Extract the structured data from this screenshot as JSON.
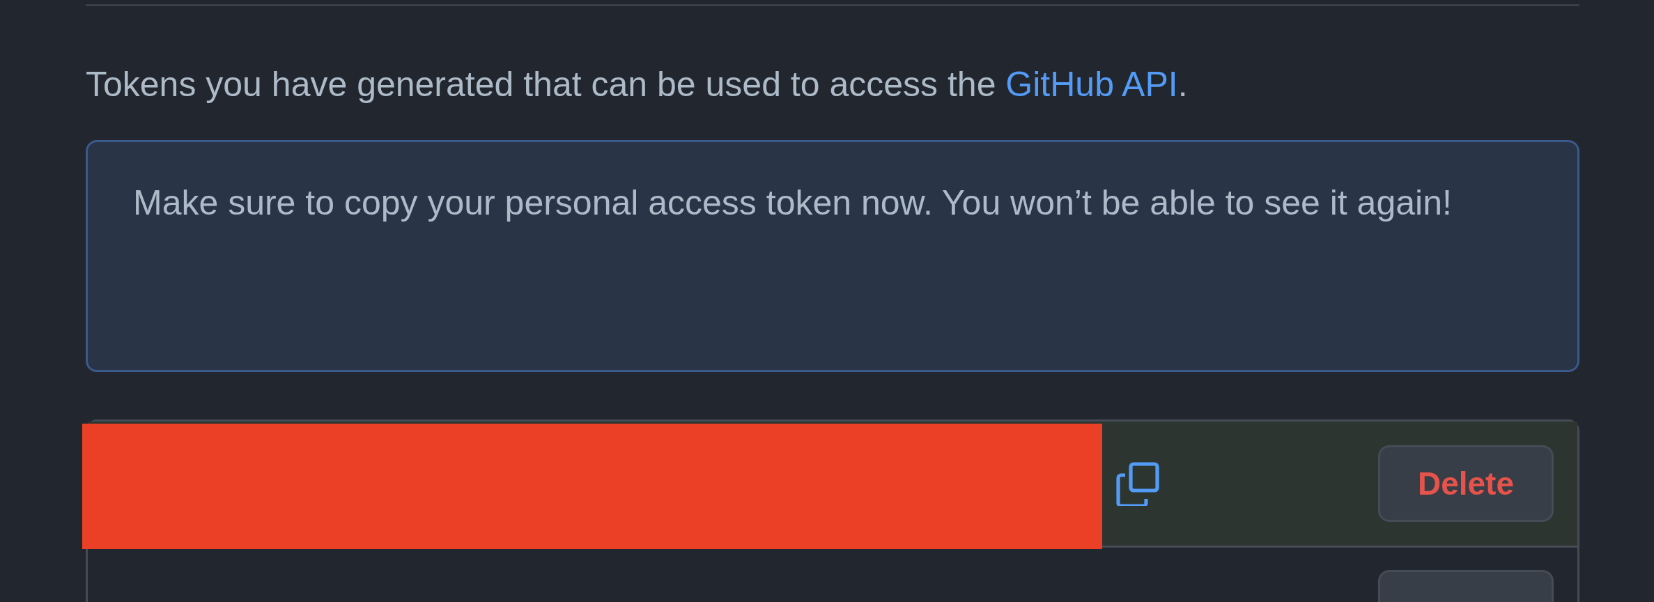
{
  "intro": {
    "text": "Tokens you have generated that can be used to access the ",
    "link": "GitHub API",
    "end": "."
  },
  "notice": "Make sure to copy your personal access token now. You won’t be able to see it again!",
  "tokens": [
    {
      "new": true,
      "delete_label": "Delete"
    },
    {
      "new": false
    }
  ]
}
